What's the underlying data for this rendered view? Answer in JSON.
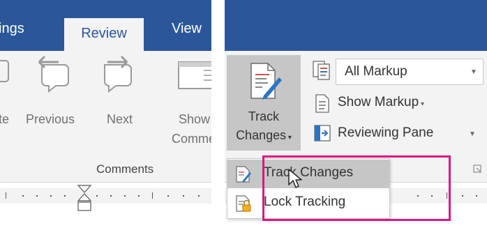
{
  "left": {
    "tabs": {
      "partial": "ings",
      "selected": "Review",
      "view": "View"
    },
    "buttons": {
      "partial_delete": "te",
      "previous": "Previous",
      "next": "Next",
      "show_line1": "Show",
      "show_line2": "Comme"
    },
    "group_label": "Comments"
  },
  "right": {
    "track_changes": {
      "line1": "Track",
      "line2": "Changes"
    },
    "display_for_review": {
      "value": "All Markup"
    },
    "show_markup": "Show Markup",
    "reviewing_pane": "Reviewing Pane",
    "menu": {
      "items": [
        {
          "label": "Track Changes",
          "icon": "track-changes-icon"
        },
        {
          "label": "Lock Tracking",
          "icon": "lock-tracking-icon"
        }
      ]
    }
  },
  "colors": {
    "ribbon_blue": "#2b579a",
    "ribbon_bg": "#f3f3f3",
    "selected_bg": "#c6c6c6",
    "highlight": "#e0157f"
  }
}
